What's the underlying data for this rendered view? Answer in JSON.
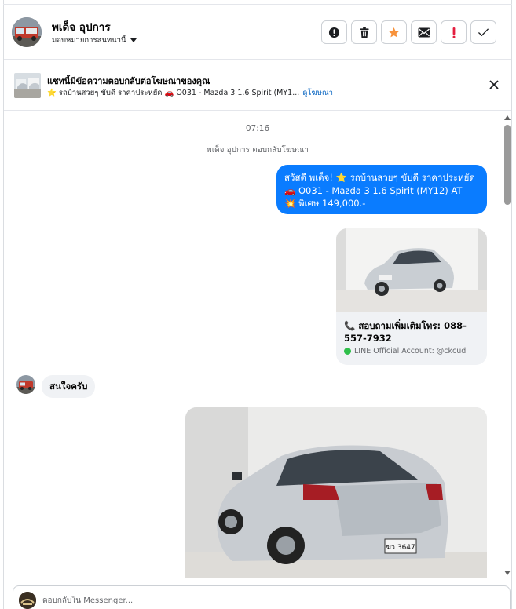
{
  "header": {
    "name": "พเด็จ อุปการ",
    "assign_label": "มอบหมายการสนทนานี้",
    "actions": [
      {
        "icon": "alert-circle-icon",
        "color": "#1c1e21"
      },
      {
        "icon": "trash-icon",
        "color": "#1c1e21"
      },
      {
        "icon": "star-icon",
        "color": "#f7923b"
      },
      {
        "icon": "envelope-icon",
        "color": "#1c1e21"
      },
      {
        "icon": "exclamation-icon",
        "color": "#e41e3f"
      },
      {
        "icon": "check-icon",
        "color": "#1c1e21"
      }
    ]
  },
  "ad_bar": {
    "title": "แชทนี้มีข้อความตอบกลับต่อโฆษณาของคุณ",
    "subtitle": "⭐ รถบ้านสวยๆ ขับดี ราคาประหยัด 🚗 O031 - Mazda 3 1.6 Spirit (MY1...",
    "link": "ดูโฆษณา"
  },
  "thread": {
    "timestamp": "07:16",
    "system_message": "พเด็จ อุปการ ตอบกลับโฆษณา",
    "outgoing": {
      "line1": "สวัสดี พเด็จ! ⭐ รถบ้านสวยๆ ขับดี ราคาประหยัด",
      "line2": "🚗 O031 - Mazda 3 1.6 Spirit (MY12) AT",
      "line3": "💥 พิเศษ 149,000.-"
    },
    "card": {
      "phone": "📞 สอบถามเพิ่มเติมโทร: 088-557-7932",
      "line_account": "LINE Official Account: @ckcud"
    },
    "incoming": "สนใจครับ",
    "photo_plate": "ฆว 3647"
  },
  "composer": {
    "placeholder": "ตอบกลับใน Messenger..."
  },
  "colors": {
    "accent": "#0a7cff",
    "incoming_bubble": "#f0f2f5",
    "link": "#0a66c2"
  }
}
